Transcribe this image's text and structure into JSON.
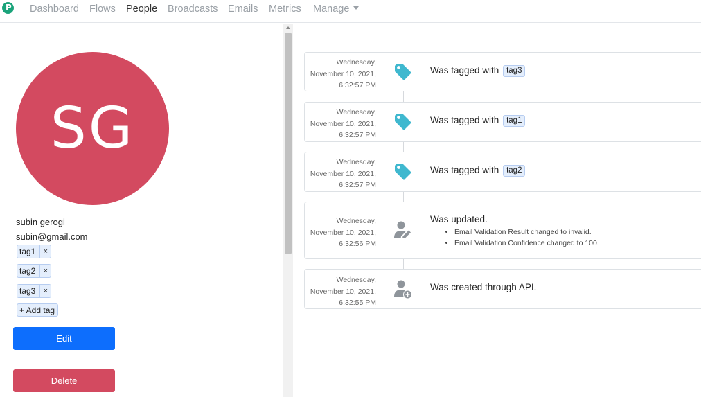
{
  "nav": {
    "logo_letter": "P",
    "items": [
      {
        "label": "Dashboard"
      },
      {
        "label": "Flows"
      },
      {
        "label": "People"
      },
      {
        "label": "Broadcasts"
      },
      {
        "label": "Emails"
      },
      {
        "label": "Metrics"
      },
      {
        "label": "Manage"
      }
    ],
    "active": "People"
  },
  "profile": {
    "initials": "SG",
    "avatar_color": "#d34a60",
    "name": "subin gerogi",
    "email": "subin@gmail.com",
    "tags": [
      {
        "label": "tag1"
      },
      {
        "label": "tag2"
      },
      {
        "label": "tag3"
      }
    ],
    "remove_glyph": "×",
    "add_tag_label": "+ Add tag",
    "edit_label": "Edit",
    "delete_label": "Delete"
  },
  "colors": {
    "primary": "#0d6efd",
    "danger": "#d34a60",
    "tag_icon": "#3fb8cf",
    "person_icon": "#8f959b"
  },
  "timeline": [
    {
      "date_l1": "Wednesday,",
      "date_l2": "November 10, 2021,",
      "date_l3": "6:32:57 PM",
      "icon": "tag-icon",
      "text": "Was tagged with",
      "badge": "tag3"
    },
    {
      "date_l1": "Wednesday,",
      "date_l2": "November 10, 2021,",
      "date_l3": "6:32:57 PM",
      "icon": "tag-icon",
      "text": "Was tagged with",
      "badge": "tag1"
    },
    {
      "date_l1": "Wednesday,",
      "date_l2": "November 10, 2021,",
      "date_l3": "6:32:57 PM",
      "icon": "tag-icon",
      "text": "Was tagged with",
      "badge": "tag2"
    },
    {
      "date_l1": "Wednesday,",
      "date_l2": "November 10, 2021,",
      "date_l3": "6:32:56 PM",
      "icon": "user-edit-icon",
      "text": "Was updated.",
      "changes": [
        "Email Validation Result changed to invalid.",
        "Email Validation Confidence changed to 100."
      ]
    },
    {
      "date_l1": "Wednesday,",
      "date_l2": "November 10, 2021,",
      "date_l3": "6:32:55 PM",
      "icon": "user-add-icon",
      "text": "Was created through API."
    }
  ]
}
